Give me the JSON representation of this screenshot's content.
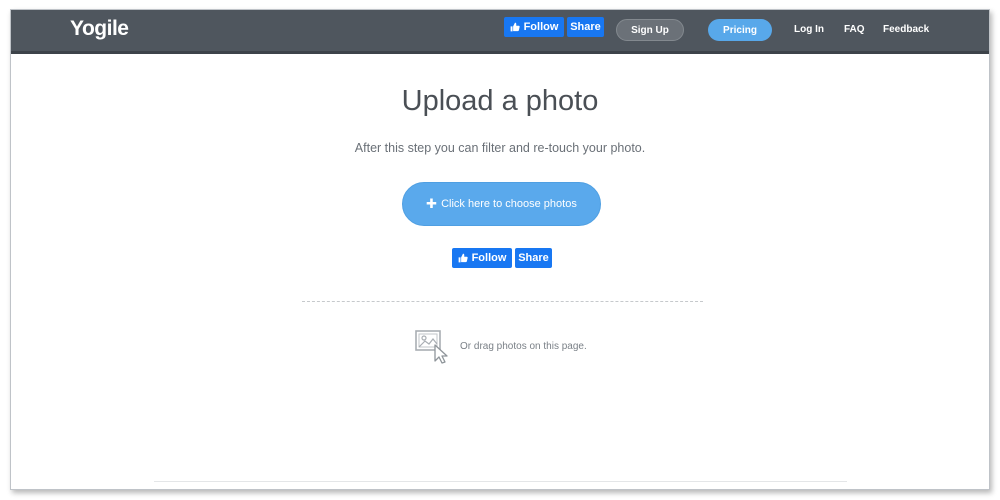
{
  "header": {
    "logo": "Yogile",
    "follow_label": "Follow",
    "share_label": "Share",
    "signup_label": "Sign Up",
    "pricing_label": "Pricing",
    "login_label": "Log In",
    "faq_label": "FAQ",
    "feedback_label": "Feedback"
  },
  "main": {
    "title": "Upload a photo",
    "subtitle": "After this step you can filter and re-touch your photo.",
    "choose_label": "Click here to choose photos",
    "follow_label": "Follow",
    "share_label": "Share",
    "drag_text": "Or drag photos on this page."
  },
  "icons": {
    "thumbs_up": "thumbs-up-icon",
    "plus": "plus-icon",
    "drag_photo": "image-drag-icon"
  },
  "colors": {
    "navbar": "#4f565e",
    "facebook": "#1877f2",
    "accent": "#58a8ea"
  }
}
